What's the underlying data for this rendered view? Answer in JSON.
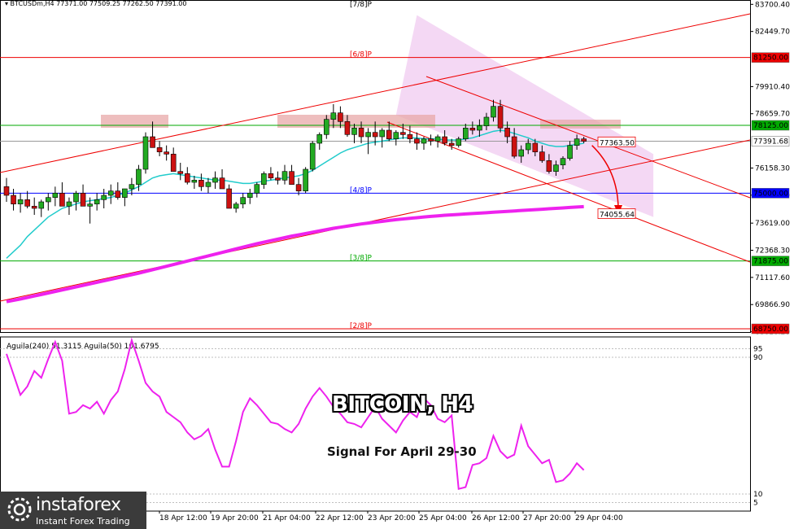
{
  "header_text": "▾ BTCUSDm,H4  77371.00 77509.25 77262.50 77391.00",
  "title": "BITCOIN, H4",
  "subtitle": "Signal For April 29-30",
  "logo": {
    "name": "instaforex",
    "tagline": "Instant Forex Trading"
  },
  "colors": {
    "candle_up": "#22aa22",
    "candle_down": "#cc1111",
    "ma21": "#22cccc",
    "ma200": "#ee22ee",
    "murrey_red": "#ee0000",
    "murrey_green": "#00aa00",
    "murrey_blue": "#0000ff",
    "channel_fill": "#f0c8f0",
    "zone": "#e8a8a8",
    "osc": "#ee22ee"
  },
  "murrey_lines": [
    {
      "label": "[7/8]P",
      "price": 85625,
      "color": "#000000"
    },
    {
      "label": "[6/8]P",
      "price": 81250,
      "color": "#ee0000"
    },
    {
      "label": "[4/8]P",
      "price": 75000,
      "color": "#0000ff"
    },
    {
      "label": "[3/8]P",
      "price": 71875,
      "color": "#00aa00"
    },
    {
      "label": "[2/8]P",
      "price": 68750,
      "color": "#ee0000"
    }
  ],
  "price_tags": [
    {
      "text": "81250.00",
      "price": 81250,
      "bg": "#ee0000",
      "fg": "#ffffff"
    },
    {
      "text": "78125.00",
      "price": 78125,
      "bg": "#00aa00",
      "fg": "#ffffff"
    },
    {
      "text": "77391.68",
      "price": 77391.68,
      "bg": "#ffffff",
      "fg": "#000000"
    },
    {
      "text": "75000.00",
      "price": 75000,
      "bg": "#0000ff",
      "fg": "#ffffff"
    },
    {
      "text": "71875.00",
      "price": 71875,
      "bg": "#00aa00",
      "fg": "#ffffff"
    },
    {
      "text": "68750.00",
      "price": 68750,
      "bg": "#ee0000",
      "fg": "#ffffff"
    }
  ],
  "annotations": [
    {
      "text": "77363.50",
      "price": 77363.5
    },
    {
      "text": "74055.64",
      "price": 74055.64
    }
  ],
  "oscillator_label": "Aguila(240) 51.3115  Aguila(50) 101.6795",
  "chart_data": {
    "type": "candlestick",
    "symbol": "BTCUSDm",
    "timeframe": "H4",
    "ylim": [
      68600,
      83900
    ],
    "y_ticks": [
      "83700.40",
      "82449.70",
      "79910.40",
      "78659.70",
      "76158.30",
      "74907.60",
      "73619.00",
      "72368.30",
      "71117.60",
      "69866.90",
      "68616.20"
    ],
    "x_ticks": [
      "18 Apr 12:00",
      "19 Apr 20:00",
      "21 Apr 04:00",
      "22 Apr 12:00",
      "23 Apr 20:00",
      "25 Apr 04:00",
      "26 Apr 12:00",
      "27 Apr 20:00",
      "29 Apr 04:00"
    ],
    "candles": [
      [
        75300,
        75700,
        74600,
        74900
      ],
      [
        74900,
        75200,
        74200,
        74500
      ],
      [
        74500,
        75000,
        74100,
        74700
      ],
      [
        74700,
        75100,
        74300,
        74400
      ],
      [
        74400,
        74800,
        74000,
        74300
      ],
      [
        74300,
        74700,
        73900,
        74600
      ],
      [
        74600,
        75000,
        74200,
        74800
      ],
      [
        74800,
        75300,
        74400,
        75000
      ],
      [
        75000,
        75500,
        74700,
        74400
      ],
      [
        74400,
        74800,
        74000,
        74600
      ],
      [
        74600,
        75100,
        74200,
        75000
      ],
      [
        75000,
        75400,
        74600,
        74400
      ],
      [
        74400,
        74800,
        73600,
        74500
      ],
      [
        74500,
        75000,
        74200,
        74700
      ],
      [
        74700,
        75200,
        74300,
        74900
      ],
      [
        74900,
        75400,
        74500,
        75100
      ],
      [
        75100,
        75500,
        74700,
        74800
      ],
      [
        74800,
        75200,
        74400,
        75200
      ],
      [
        75200,
        75700,
        74900,
        75400
      ],
      [
        75400,
        76300,
        75100,
        76100
      ],
      [
        76100,
        77800,
        75900,
        77600
      ],
      [
        77600,
        78300,
        77100,
        77100
      ],
      [
        77100,
        77400,
        76700,
        76900
      ],
      [
        76900,
        77200,
        76500,
        76800
      ],
      [
        76800,
        77100,
        76200,
        76000
      ],
      [
        76000,
        76400,
        75600,
        75900
      ],
      [
        75900,
        76200,
        75400,
        75500
      ],
      [
        75500,
        75800,
        75200,
        75600
      ],
      [
        75600,
        75900,
        75100,
        75300
      ],
      [
        75300,
        75700,
        75000,
        75500
      ],
      [
        75500,
        76000,
        75200,
        75700
      ],
      [
        75700,
        76100,
        75400,
        75200
      ],
      [
        75200,
        75400,
        74600,
        74300
      ],
      [
        74300,
        74600,
        74100,
        74500
      ],
      [
        74500,
        75000,
        74300,
        74800
      ],
      [
        74800,
        75200,
        74500,
        75000
      ],
      [
        75000,
        75500,
        74800,
        75400
      ],
      [
        75400,
        76000,
        75200,
        75900
      ],
      [
        75900,
        76200,
        75600,
        75700
      ],
      [
        75700,
        76000,
        75400,
        75600
      ],
      [
        75600,
        76300,
        75400,
        76000
      ],
      [
        76000,
        76300,
        75500,
        75400
      ],
      [
        75400,
        75700,
        74900,
        75100
      ],
      [
        75100,
        76200,
        75000,
        76100
      ],
      [
        76100,
        77400,
        76000,
        77300
      ],
      [
        77300,
        77800,
        77000,
        77700
      ],
      [
        77700,
        78600,
        77500,
        78400
      ],
      [
        78400,
        79100,
        78000,
        78700
      ],
      [
        78700,
        79000,
        78000,
        78300
      ],
      [
        78300,
        78600,
        77600,
        77700
      ],
      [
        77700,
        78200,
        77300,
        78000
      ],
      [
        78000,
        78300,
        77300,
        77600
      ],
      [
        77600,
        78000,
        76800,
        77800
      ],
      [
        77800,
        78300,
        77200,
        77600
      ],
      [
        77600,
        78000,
        77100,
        77900
      ],
      [
        77900,
        78300,
        77400,
        77500
      ],
      [
        77500,
        77900,
        77200,
        77800
      ],
      [
        77800,
        78200,
        77500,
        77700
      ],
      [
        77700,
        78100,
        77300,
        77500
      ],
      [
        77500,
        77800,
        77000,
        77300
      ],
      [
        77300,
        77600,
        77000,
        77500
      ],
      [
        77500,
        77700,
        77200,
        77400
      ],
      [
        77400,
        77700,
        77100,
        77600
      ],
      [
        77600,
        77900,
        77200,
        77300
      ],
      [
        77300,
        77500,
        77000,
        77200
      ],
      [
        77200,
        77600,
        77100,
        77500
      ],
      [
        77500,
        78200,
        77400,
        78000
      ],
      [
        78000,
        78300,
        77700,
        77900
      ],
      [
        77900,
        78400,
        77600,
        78100
      ],
      [
        78100,
        78700,
        77900,
        78500
      ],
      [
        78500,
        79300,
        78300,
        79000
      ],
      [
        79000,
        79300,
        77800,
        78000
      ],
      [
        78000,
        78300,
        77300,
        77600
      ],
      [
        77600,
        78000,
        76600,
        76700
      ],
      [
        76700,
        77200,
        76400,
        77000
      ],
      [
        77000,
        77500,
        76800,
        77300
      ],
      [
        77300,
        77500,
        76700,
        76900
      ],
      [
        76900,
        77200,
        76400,
        76500
      ],
      [
        76500,
        76800,
        75900,
        76000
      ],
      [
        76000,
        76500,
        75800,
        76300
      ],
      [
        76300,
        76700,
        76100,
        76600
      ],
      [
        76600,
        77400,
        76500,
        77200
      ],
      [
        77200,
        77700,
        77000,
        77500
      ],
      [
        77500,
        77600,
        77300,
        77391
      ]
    ],
    "ma21": [
      72000,
      72300,
      72600,
      73000,
      73300,
      73600,
      73900,
      74100,
      74300,
      74400,
      74500,
      74600,
      74650,
      74700,
      74750,
      74800,
      74900,
      75000,
      75150,
      75300,
      75500,
      75700,
      75800,
      75850,
      75900,
      75850,
      75800,
      75750,
      75700,
      75650,
      75600,
      75600,
      75550,
      75500,
      75450,
      75450,
      75500,
      75550,
      75600,
      75650,
      75700,
      75750,
      75800,
      75900,
      76050,
      76250,
      76450,
      76650,
      76850,
      77000,
      77100,
      77200,
      77300,
      77350,
      77400,
      77450,
      77500,
      77550,
      77550,
      77550,
      77500,
      77500,
      77500,
      77450,
      77450,
      77450,
      77500,
      77550,
      77650,
      77750,
      77850,
      77900,
      77850,
      77750,
      77650,
      77550,
      77400,
      77300,
      77200,
      77150,
      77150,
      77200,
      77250,
      77300
    ],
    "ma200": [
      70000,
      70060,
      70120,
      70190,
      70260,
      70330,
      70400,
      70470,
      70540,
      70610,
      70680,
      70750,
      70820,
      70890,
      70960,
      71030,
      71100,
      71170,
      71240,
      71310,
      71390,
      71470,
      71550,
      71630,
      71710,
      71790,
      71870,
      71950,
      72030,
      72110,
      72190,
      72270,
      72350,
      72430,
      72510,
      72590,
      72670,
      72740,
      72810,
      72880,
      72950,
      73020,
      73080,
      73140,
      73200,
      73260,
      73320,
      73380,
      73430,
      73480,
      73530,
      73580,
      73620,
      73660,
      73700,
      73740,
      73780,
      73810,
      73840,
      73870,
      73900,
      73930,
      73955,
      73980,
      74000,
      74020,
      74040,
      74060,
      74080,
      74100,
      74120,
      74140,
      74160,
      74180,
      74200,
      74220,
      74240,
      74260,
      74280,
      74300,
      74320,
      74340,
      74360,
      74380
    ],
    "oscillator": {
      "label": "Aguila(240) 51.3115  Aguila(50) 101.6795",
      "levels": [
        95,
        90,
        10,
        5
      ],
      "ylim": [
        0,
        100
      ],
      "values": [
        92,
        80,
        68,
        73,
        82,
        78,
        89,
        99,
        88,
        57,
        58,
        62,
        60,
        64,
        57,
        65,
        70,
        83,
        100,
        88,
        75,
        70,
        67,
        58,
        55,
        52,
        46,
        42,
        44,
        48,
        36,
        26,
        26,
        41,
        58,
        66,
        62,
        57,
        52,
        51,
        48,
        46,
        51,
        60,
        67,
        72,
        67,
        61,
        57,
        52,
        51,
        49,
        55,
        61,
        54,
        50,
        46,
        53,
        58,
        55,
        66,
        62,
        54,
        52,
        56,
        13,
        14,
        27,
        28,
        31,
        44,
        35,
        31,
        33,
        50,
        38,
        33,
        28,
        30,
        17,
        18,
        22,
        28,
        24
      ]
    }
  }
}
